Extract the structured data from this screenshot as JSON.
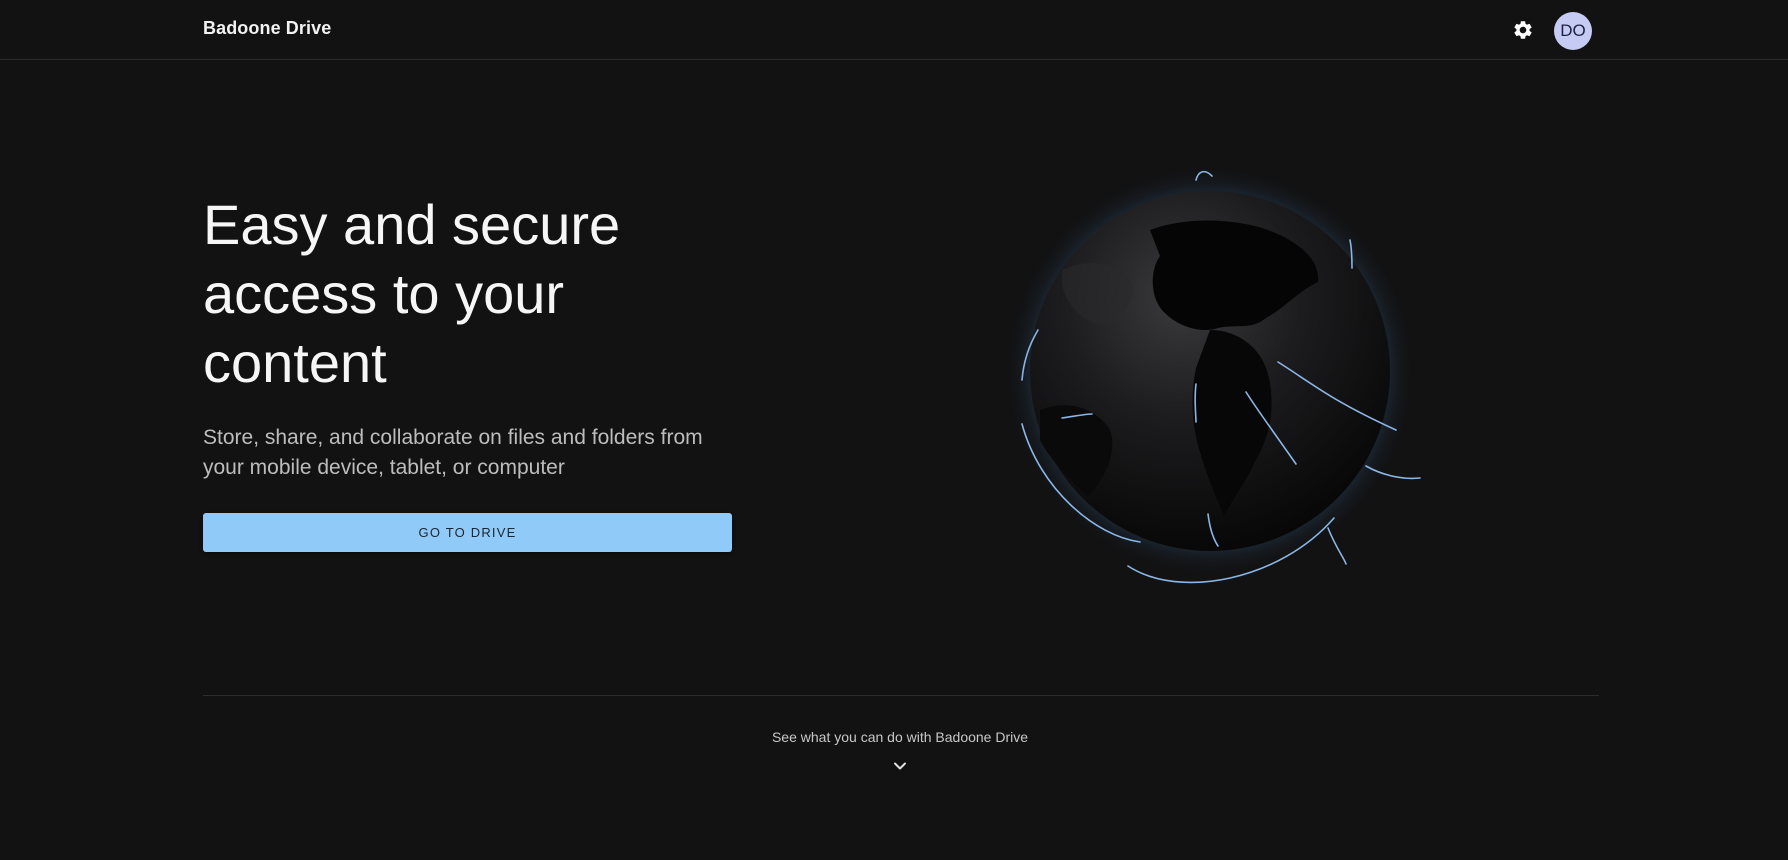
{
  "header": {
    "brand": "Badoone Drive",
    "settings_icon": "gear-icon",
    "avatar_initials": "DO"
  },
  "hero": {
    "title": "Easy and secure access to your content",
    "subtitle": "Store, share, and collaborate on files and folders from your mobile device, tablet, or computer",
    "cta_label": "GO TO DRIVE",
    "illustration": "globe-illustration"
  },
  "explore": {
    "label": "See what you can do with Badoone Drive",
    "icon": "chevron-down-icon"
  },
  "colors": {
    "background": "#121213",
    "accent": "#90caf9",
    "avatar_bg": "#c5cbf3",
    "arc": "#8ab6e6"
  }
}
